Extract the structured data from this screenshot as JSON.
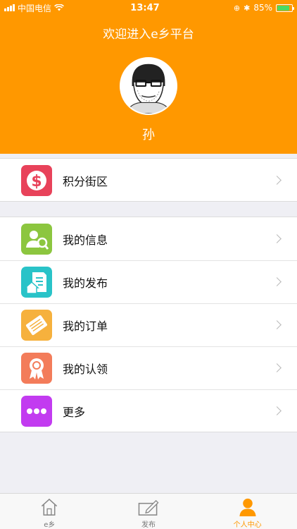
{
  "status_bar": {
    "carrier": "中国电信",
    "time": "13:47",
    "battery": "85%",
    "battery_level": 0.85
  },
  "header": {
    "title": "欢迎进入e乡平台",
    "username": "孙",
    "avatar_icon": "user-avatar-icon",
    "background": "#ff9800"
  },
  "menu_group1": [
    {
      "label": "积分街区",
      "icon": "points-dollar-icon",
      "color": "#e8425a"
    }
  ],
  "menu_group2": [
    {
      "label": "我的信息",
      "icon": "user-search-icon",
      "color": "#8cc63f"
    },
    {
      "label": "我的发布",
      "icon": "house-document-icon",
      "color": "#29c3c8"
    },
    {
      "label": "我的订单",
      "icon": "ticket-icon",
      "color": "#f6b13d"
    },
    {
      "label": "我的认领",
      "icon": "award-badge-icon",
      "color": "#f37c5a"
    },
    {
      "label": "更多",
      "icon": "more-dots-icon",
      "color": "#c23bf0"
    }
  ],
  "tabbar": {
    "active_color": "#ff9800",
    "items": [
      {
        "label": "e乡",
        "icon": "home-icon"
      },
      {
        "label": "发布",
        "icon": "compose-icon"
      },
      {
        "label": "个人中心",
        "icon": "person-icon"
      }
    ]
  }
}
